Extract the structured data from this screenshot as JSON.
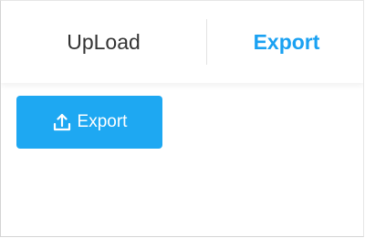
{
  "tabs": [
    {
      "label": "UpLoad",
      "active": false
    },
    {
      "label": "Export",
      "active": true
    }
  ],
  "export_button": {
    "label": "Export",
    "icon": "upload-icon"
  },
  "colors": {
    "accent": "#1aa1f2",
    "button_bg": "#1ea8f2",
    "text": "#333333"
  }
}
